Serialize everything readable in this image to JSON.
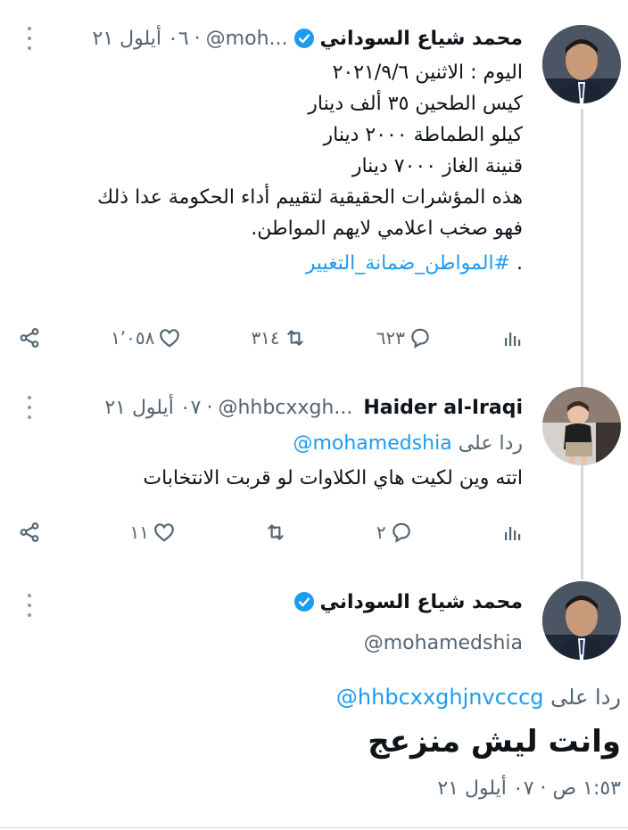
{
  "tweet1": {
    "name": "محمد شياع السوداني",
    "handle": "@moh...",
    "dot": "·",
    "date": "٠٦ أيلول ٢١",
    "lines": [
      "اليوم : الاثنين ٢٠٢١/٩/٦",
      "كيس الطحين  ٣٥ ألف دينار",
      "كيلو الطماطة  ٢٠٠٠ دينار",
      "قنينة الغاز  ٧٠٠٠ دينار",
      "هذه المؤشرات الحقيقية لتقييم أداء الحكومة عدا ذلك",
      "فهو صخب اعلامي لايهم المواطن."
    ],
    "hashtag_prefix": ". ",
    "hashtag": "#المواطن_ضمانة_التغيير",
    "replies": "٦٢٣",
    "retweets": "٣١٤",
    "likes": "١٬٠٥٨"
  },
  "tweet2": {
    "name": "Haider al-Iraqi",
    "handle": "@hhbcxxgh...",
    "dot": "·",
    "date": "٠٧ أيلول ٢١",
    "reply_label": "ردا على",
    "reply_mention": "@mohamedshia",
    "text": "اتته وين لكيت هاي الكلاوات لو قربت الانتخابات",
    "replies": "٢",
    "likes": "١١"
  },
  "tweet3": {
    "name": "محمد شياع السوداني",
    "handle": "@mohamedshia",
    "reply_label": "ردا على",
    "reply_mention": "@hhbcxxghjnvcccg",
    "text": "وانت ليش منزعج",
    "timestamp": "١:٥٣ ص · ٠٧ أيلول ٢١"
  },
  "colors": {
    "accent": "#1d9bf0",
    "muted": "#536471",
    "text": "#0f1419",
    "line": "#cfd9de"
  },
  "icons": [
    "verified-icon",
    "more-icon",
    "reply-icon",
    "retweet-icon",
    "like-icon",
    "share-icon",
    "analytics-icon"
  ]
}
